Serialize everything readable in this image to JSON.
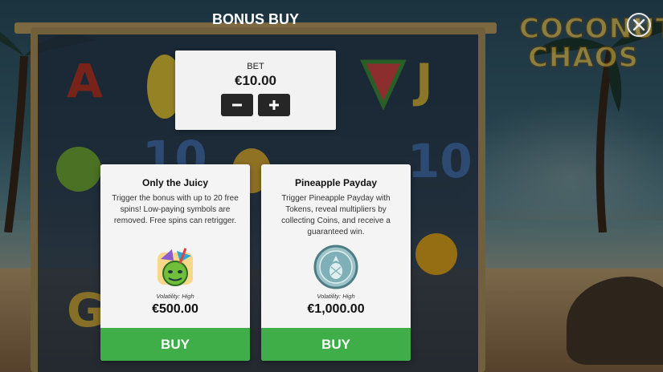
{
  "title": "BONUS BUY",
  "logo": {
    "line1": "COCONUT",
    "line2": "CHAOS"
  },
  "bet": {
    "label": "BET",
    "value": "€10.00",
    "minus": "−",
    "plus": "+"
  },
  "bonuses": [
    {
      "title": "Only the Juicy",
      "description": "Trigger the bonus with up to 20 free spins! Low-paying symbols are removed. Free spins can retrigger.",
      "icon": "coconut-drink-icon",
      "volatility": "Volatility: High",
      "price": "€500.00",
      "buy_label": "BUY"
    },
    {
      "title": "Pineapple Payday",
      "description": "Trigger Pineapple Payday with Tokens, reveal multipliers by collecting Coins, and receive a guaranteed win.",
      "icon": "pineapple-coin-icon",
      "volatility": "Volatility: High",
      "price": "€1,000.00",
      "buy_label": "BUY"
    }
  ],
  "colors": {
    "buy": "#3fae49",
    "panel": "#f2f2f2",
    "logo": "#e6b93a"
  }
}
